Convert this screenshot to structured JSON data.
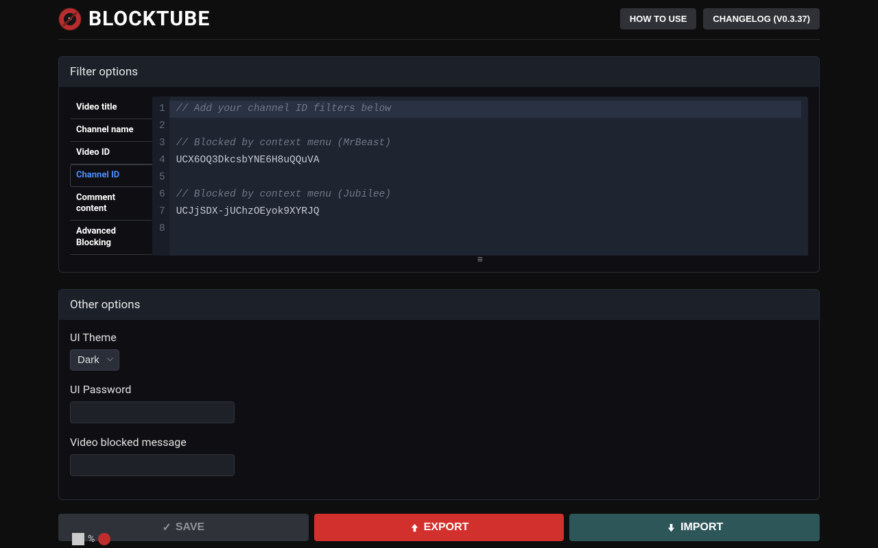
{
  "header": {
    "brand": "BLOCKTUBE",
    "how_to_use": "HOW TO USE",
    "changelog": "CHANGELOG (V0.3.37)"
  },
  "filter_panel": {
    "title": "Filter options",
    "tabs": [
      {
        "label": "Video title",
        "active": false
      },
      {
        "label": "Channel name",
        "active": false
      },
      {
        "label": "Video ID",
        "active": false
      },
      {
        "label": "Channel ID",
        "active": true
      },
      {
        "label": "Comment content",
        "active": false
      },
      {
        "label": "Advanced Blocking",
        "active": false
      }
    ],
    "code_lines": [
      {
        "n": "1",
        "text": "// Add your channel ID filters below",
        "comment": true,
        "active": true
      },
      {
        "n": "2",
        "text": "",
        "comment": false,
        "active": false
      },
      {
        "n": "3",
        "text": "// Blocked by context menu (MrBeast)",
        "comment": true,
        "active": false
      },
      {
        "n": "4",
        "text": "UCX6OQ3DkcsbYNE6H8uQQuVA",
        "comment": false,
        "active": false
      },
      {
        "n": "5",
        "text": "",
        "comment": false,
        "active": false
      },
      {
        "n": "6",
        "text": "// Blocked by context menu (Jubilee)",
        "comment": true,
        "active": false
      },
      {
        "n": "7",
        "text": "UCJjSDX-jUChzOEyok9XYRJQ",
        "comment": false,
        "active": false
      },
      {
        "n": "8",
        "text": "",
        "comment": false,
        "active": false
      }
    ],
    "drag_glyph": "≡"
  },
  "other_panel": {
    "title": "Other options",
    "ui_theme_label": "UI Theme",
    "ui_theme_value": "Dark",
    "ui_password_label": "UI Password",
    "ui_password_value": "",
    "video_blocked_label": "Video blocked message",
    "video_blocked_value": ""
  },
  "actions": {
    "save": "SAVE",
    "export": "EXPORT",
    "import": "IMPORT",
    "save_icon": "✓"
  },
  "stray": {
    "text1": "",
    "pct": "%"
  }
}
